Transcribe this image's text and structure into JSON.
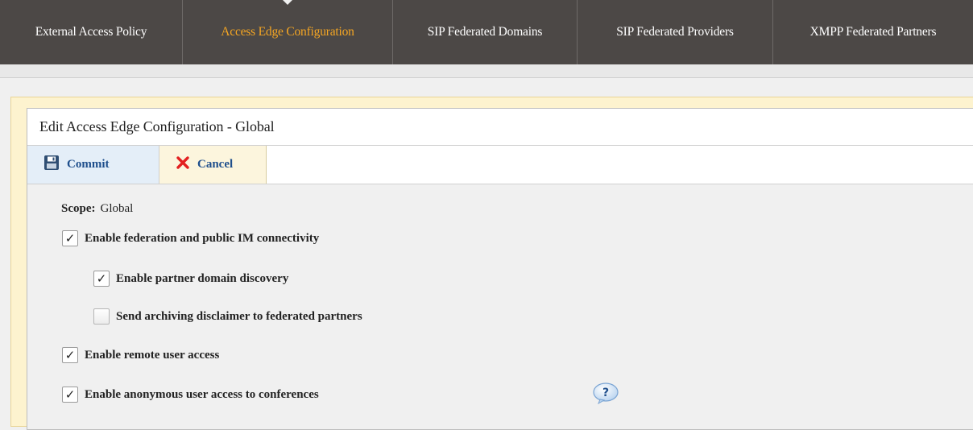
{
  "tabs": [
    {
      "label": "External Access Policy",
      "active": false
    },
    {
      "label": "Access Edge Configuration",
      "active": true
    },
    {
      "label": "SIP Federated Domains",
      "active": false
    },
    {
      "label": "SIP Federated Providers",
      "active": false
    },
    {
      "label": "XMPP Federated Partners",
      "active": false
    }
  ],
  "panel": {
    "title": "Edit Access Edge Configuration - Global",
    "toolbar": {
      "commit_label": "Commit",
      "commit_icon": "save-icon",
      "cancel_label": "Cancel",
      "cancel_icon": "close-icon"
    },
    "scope_label": "Scope:",
    "scope_value": "Global",
    "options": [
      {
        "label": "Enable federation and public IM connectivity",
        "checked": true
      },
      {
        "label": "Enable partner domain discovery",
        "checked": true
      },
      {
        "label": "Send archiving disclaimer to federated partners",
        "checked": false
      },
      {
        "label": "Enable remote user access",
        "checked": true
      },
      {
        "label": "Enable anonymous user access to conferences",
        "checked": true
      }
    ],
    "help_icon": "help-icon"
  },
  "colors": {
    "tabbar_bg": "#4c4846",
    "tab_active": "#f5a623",
    "link_blue": "#1e4e8c",
    "cancel_red": "#e32020",
    "frame_yellow": "#fdf3cf"
  }
}
